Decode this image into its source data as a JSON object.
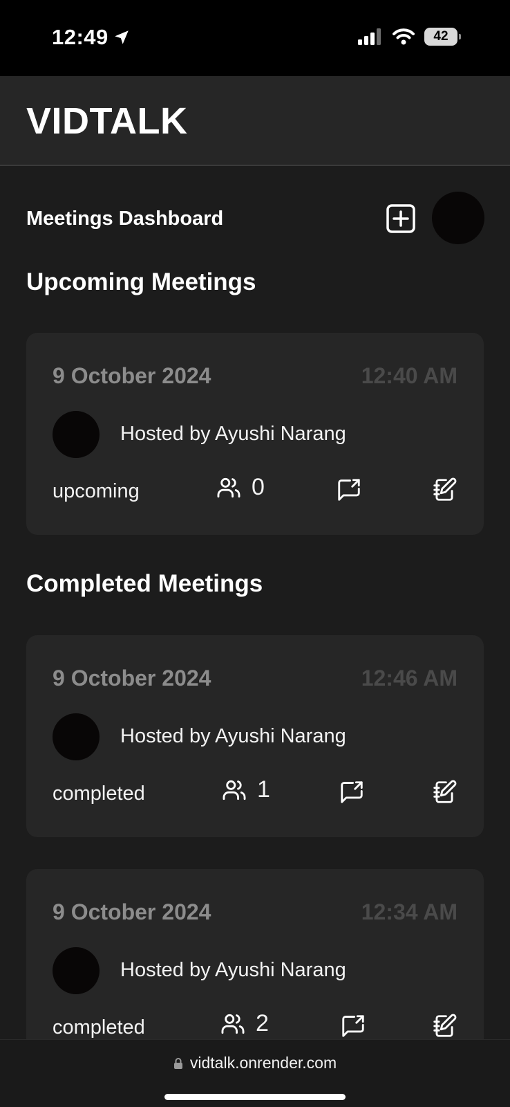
{
  "status_bar": {
    "time": "12:49",
    "battery": "42",
    "icons": [
      "location-arrow-icon",
      "signal-bars-icon",
      "wifi-icon",
      "battery-icon"
    ]
  },
  "app": {
    "brand": "VIDTALK"
  },
  "dashboard": {
    "title": "Meetings Dashboard",
    "add_icon": "plus-square-icon"
  },
  "sections": {
    "upcoming_title": "Upcoming Meetings",
    "completed_title": "Completed Meetings"
  },
  "meetings": [
    {
      "date": "9 October 2024",
      "time": "12:40 AM",
      "host": "Hosted by Ayushi Narang",
      "status": "upcoming",
      "participants": "0"
    },
    {
      "date": "9 October 2024",
      "time": "12:46 AM",
      "host": "Hosted by Ayushi Narang",
      "status": "completed",
      "participants": "1"
    },
    {
      "date": "9 October 2024",
      "time": "12:34 AM",
      "host": "Hosted by Ayushi Narang",
      "status": "completed",
      "participants": "2"
    }
  ],
  "browser": {
    "url": "vidtalk.onrender.com"
  },
  "colors": {
    "background": "#1c1c1c",
    "card": "#262626",
    "header": "#262626",
    "date_text": "#8c8c8c",
    "time_text": "#4a4a4a"
  }
}
